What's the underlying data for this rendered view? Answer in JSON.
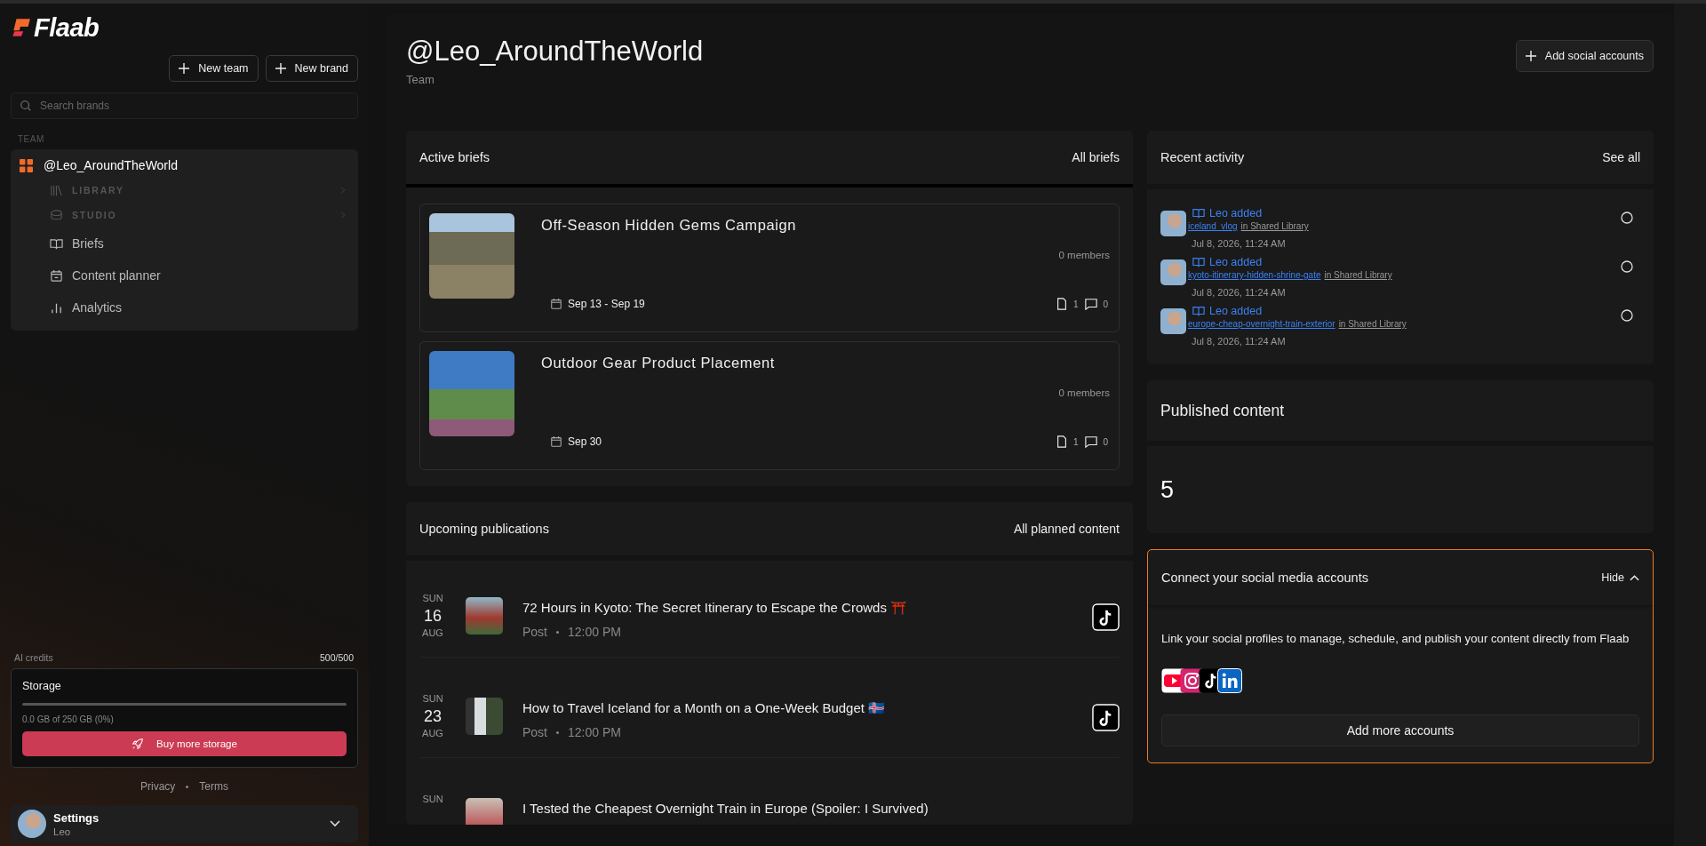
{
  "sidebar": {
    "logo": "Flaab",
    "buttons": [
      "New team",
      "New brand"
    ],
    "search": {
      "placeholder": "Search brands"
    },
    "section_label": "TEAM",
    "team": {
      "name": "@Leo_AroundTheWorld",
      "items": [
        {
          "label": "LIBRARY",
          "kind": "section"
        },
        {
          "label": "STUDIO",
          "kind": "section"
        },
        {
          "label": "Briefs",
          "kind": "link"
        },
        {
          "label": "Content planner",
          "kind": "link"
        },
        {
          "label": "Analytics",
          "kind": "link"
        }
      ]
    },
    "ai_credits": {
      "label": "AI credits",
      "value": "500/500"
    },
    "storage": {
      "title": "Storage",
      "level": 0,
      "usage": "0.0 GB of 250 GB (0%)",
      "button": "Buy more storage"
    },
    "footer_links": [
      "Privacy",
      "Terms"
    ],
    "user": {
      "title": "Settings",
      "name": "Leo"
    }
  },
  "header": {
    "title": "@Leo_AroundTheWorld",
    "subtitle": "Team",
    "button": "Add social accounts"
  },
  "active_briefs": {
    "title": "Active briefs",
    "link": "All briefs",
    "briefs": [
      {
        "title": "Off-Season Hidden Gems Campaign",
        "members": "0 members",
        "dates": "Sep 13 - Sep 19",
        "files": "1",
        "comments": "0"
      },
      {
        "title": "Outdoor Gear Product Placement",
        "members": "0 members",
        "dates": "Sep 30",
        "files": "1",
        "comments": "0"
      }
    ]
  },
  "upcoming": {
    "title": "Upcoming publications",
    "link": "All planned content",
    "items": [
      {
        "weekday": "SUN",
        "day": "16",
        "month": "AUG",
        "title": "72 Hours in Kyoto: The Secret Itinerary to Escape the Crowds ⛩️",
        "type": "Post",
        "time": "12:00 PM"
      },
      {
        "weekday": "SUN",
        "day": "23",
        "month": "AUG",
        "title": "How to Travel Iceland for a Month on a One-Week Budget 🇮🇸",
        "type": "Post",
        "time": "12:00 PM"
      },
      {
        "weekday": "SUN",
        "title": "I Tested the Cheapest Overnight Train in Europe (Spoiler: I Survived)"
      }
    ]
  },
  "recent_activity": {
    "title": "Recent activity",
    "link": "See all",
    "items": [
      {
        "action": "Leo added",
        "file": "iceland_vlog",
        "place": "in Shared Library",
        "time": "Jul 8, 2026, 11:24 AM"
      },
      {
        "action": "Leo added",
        "file": "kyoto-itinerary-hidden-shrine-gate",
        "place": "in Shared Library",
        "time": "Jul 8, 2026, 11:24 AM"
      },
      {
        "action": "Leo added",
        "file": "europe-cheap-overnight-train-exterior",
        "place": "in Shared Library",
        "time": "Jul 8, 2026, 11:24 AM"
      }
    ]
  },
  "published": {
    "title": "Published content",
    "count": "5"
  },
  "connect": {
    "title": "Connect your social media accounts",
    "toggle": "Hide",
    "expanded": true,
    "text": "Link your social profiles to manage, schedule, and publish your content directly from Flaab",
    "networks": [
      {
        "kind": "youtube"
      },
      {
        "kind": "instagram"
      },
      {
        "kind": "tiktok"
      },
      {
        "kind": "linkedin"
      }
    ],
    "button": "Add more accounts"
  }
}
